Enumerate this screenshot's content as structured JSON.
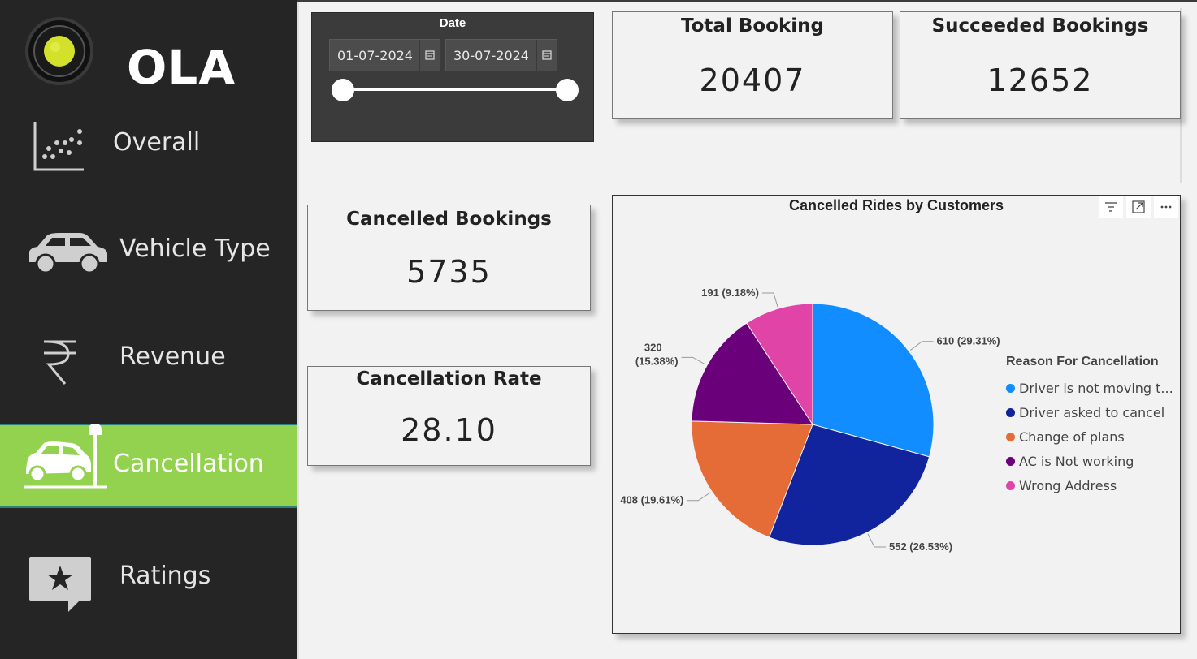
{
  "sidebar": {
    "logo_text": "OLA",
    "items": [
      {
        "label": "Overall",
        "icon": "scatter-chart-icon"
      },
      {
        "label": "Vehicle Type",
        "icon": "car-icon"
      },
      {
        "label": "Revenue",
        "icon": "rupee-icon"
      },
      {
        "label": "Cancellation",
        "icon": "car-crash-icon",
        "active": true
      },
      {
        "label": "Ratings",
        "icon": "star-message-icon"
      }
    ]
  },
  "date_slicer": {
    "title": "Date",
    "start": "01-07-2024",
    "end": "30-07-2024"
  },
  "cards": {
    "total_booking": {
      "title": "Total Booking",
      "value": "20407"
    },
    "succeeded_bookings": {
      "title": "Succeeded Bookings",
      "value": "12652"
    },
    "cancelled_bookings": {
      "title": "Cancelled Bookings",
      "value": "5735"
    },
    "cancellation_rate": {
      "title": "Cancellation Rate",
      "value": "28.10"
    }
  },
  "chart_data": {
    "type": "pie",
    "title": "Cancelled Rides by Customers",
    "legend_title": "Reason For Cancellation",
    "legend_position": "right",
    "slices": [
      {
        "name": "Driver is not moving t...",
        "value": 610,
        "label": "610 (29.31%)",
        "color": "#118dff"
      },
      {
        "name": "Driver asked to cancel",
        "value": 552,
        "label": "552 (26.53%)",
        "color": "#12239e"
      },
      {
        "name": "Change of plans",
        "value": 408,
        "label": "408 (19.61%)",
        "color": "#e66c37"
      },
      {
        "name": "AC is Not working",
        "value": 320,
        "label": "320 (15.38%)",
        "color": "#6b007b"
      },
      {
        "name": "Wrong Address",
        "value": 191,
        "label": "191 (9.18%)",
        "color": "#e044a7"
      }
    ]
  },
  "colors": {
    "sidebar_bg": "#252525",
    "active_nav": "#93d24f",
    "slicer_bg": "#3b3b3b",
    "page_bg": "#f2f2f2"
  }
}
